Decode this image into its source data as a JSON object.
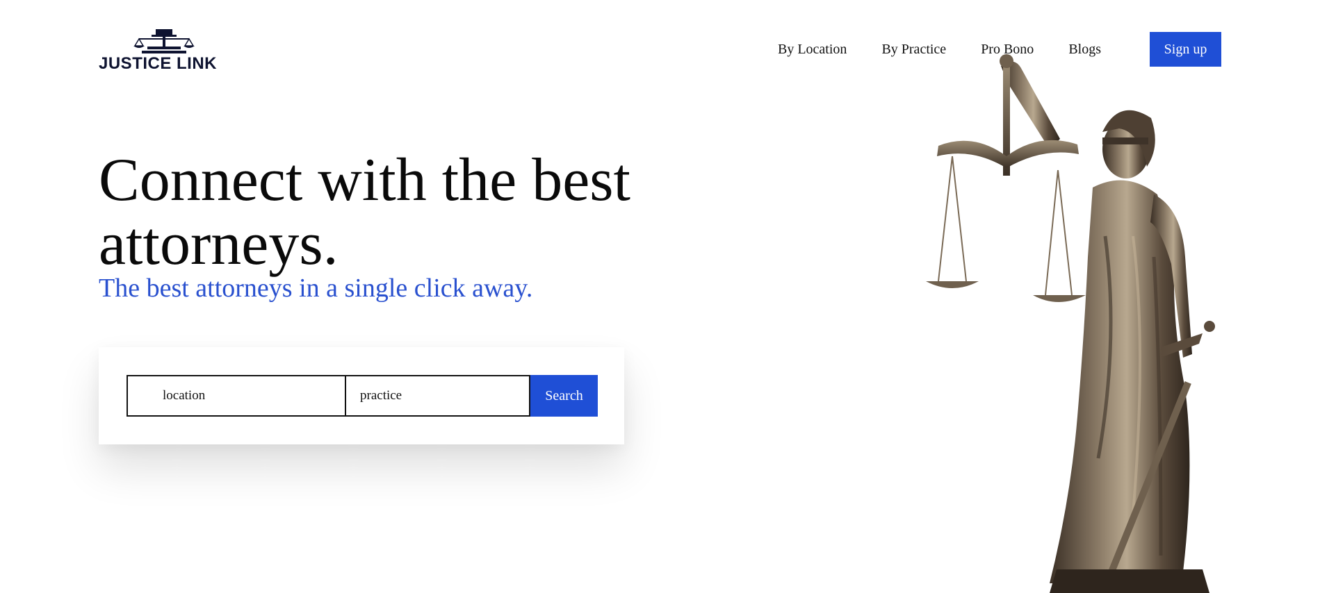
{
  "brand": {
    "name": "JUSTICE LINK"
  },
  "nav": {
    "items": [
      {
        "label": "By Location"
      },
      {
        "label": "By Practice"
      },
      {
        "label": "Pro Bono"
      },
      {
        "label": "Blogs"
      }
    ],
    "signup_label": "Sign up"
  },
  "hero": {
    "title": "Connect with the best attorneys.",
    "subtitle": "The best attorneys in a single click away."
  },
  "search": {
    "location_placeholder": "location",
    "practice_placeholder": "practice",
    "button_label": "Search"
  },
  "colors": {
    "accent": "#1f4fd6",
    "subtitle": "#2a51cf",
    "logo": "#0e1330"
  },
  "icons": {
    "logo": "scales-of-justice-icon",
    "hero_image": "lady-justice-statue"
  }
}
